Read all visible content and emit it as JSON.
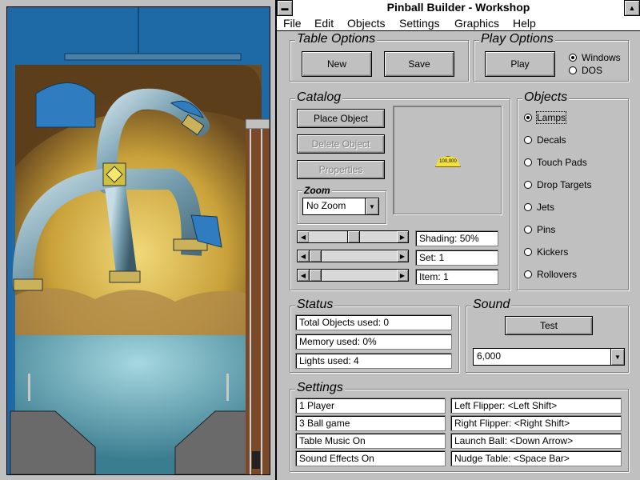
{
  "window": {
    "title": "Pinball Builder - Workshop"
  },
  "menu": [
    "File",
    "Edit",
    "Objects",
    "Settings",
    "Graphics",
    "Help"
  ],
  "table_options": {
    "title": "Table Options",
    "new": "New",
    "save": "Save"
  },
  "play_options": {
    "title": "Play Options",
    "play": "Play",
    "platforms": [
      "Windows",
      "DOS"
    ],
    "selected": "Windows"
  },
  "catalog": {
    "title": "Catalog",
    "place": "Place Object",
    "delete": "Delete Object",
    "properties": "Properties",
    "zoom_label": "Zoom",
    "zoom_value": "No Zoom",
    "preview_label": "100,000",
    "sliders": [
      {
        "label": "Shading: 50%",
        "value": 0.5
      },
      {
        "label": "Set: 1",
        "value": 0
      },
      {
        "label": "Item: 1",
        "value": 0
      }
    ]
  },
  "objects": {
    "title": "Objects",
    "items": [
      "Lamps",
      "Decals",
      "Touch Pads",
      "Drop Targets",
      "Jets",
      "Pins",
      "Kickers",
      "Rollovers"
    ],
    "selected": "Lamps"
  },
  "status": {
    "title": "Status",
    "lines": [
      "Total Objects used: 0",
      "Memory used: 0%",
      "Lights used: 4"
    ]
  },
  "sound": {
    "title": "Sound",
    "test": "Test",
    "rate": "6,000"
  },
  "settings": {
    "title": "Settings",
    "left": [
      "1 Player",
      "3 Ball game",
      "Table Music On",
      "Sound Effects On"
    ],
    "right": [
      "Left Flipper:  <Left Shift>",
      "Right Flipper:  <Right Shift>",
      "Launch Ball:  <Down Arrow>",
      "Nudge Table:  <Space Bar>"
    ]
  },
  "colors": {
    "table_blue": "#1e6aa6",
    "ramp": "#7fa6b8",
    "backdrop": "#c9a13a"
  }
}
